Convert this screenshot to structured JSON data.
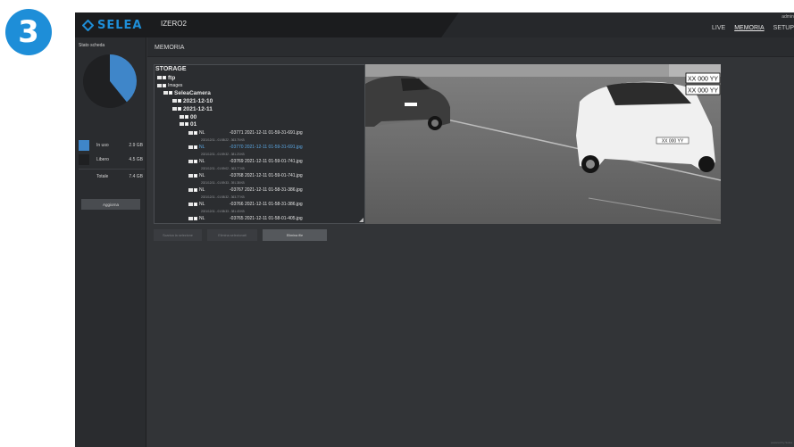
{
  "step_badge": "3",
  "brand": {
    "name": "SELEA",
    "accent": "#1e8ed8"
  },
  "device_name": "IZERO2",
  "user": {
    "name": "admin"
  },
  "nav": {
    "live": "LIVE",
    "memoria": "MEMORIA",
    "setup": "SETUP",
    "active": "MEMORIA"
  },
  "sidebar": {
    "title": "Stato scheda",
    "chart_data": {
      "type": "pie",
      "slices": [
        {
          "label": "In uso",
          "value": 2.9,
          "color": "#3f86c9"
        },
        {
          "label": "Libero",
          "value": 4.5,
          "color": "#1f2022"
        }
      ]
    },
    "legend": [
      {
        "label": "In uso",
        "value": "2.9 GB",
        "color": "#3f86c9"
      },
      {
        "label": "Libero",
        "value": "4.5 GB",
        "color": "#1f2022"
      },
      {
        "label": "Totale",
        "value": "7.4 GB",
        "color": ""
      }
    ],
    "update_button": "Aggiorna"
  },
  "page_title": "MEMORIA",
  "tree": {
    "title": "STORAGE",
    "nodes": [
      "ftp",
      "Images",
      "SeleaCamera",
      "2021-12-10",
      "2021-12-11",
      "00",
      "01"
    ],
    "files": [
      {
        "plate": "NL",
        "name": "-03771 2021-12-11 01-59-31-691.jpg",
        "meta": "2021/12/11 - 01:58:22 - 363.75 KB",
        "selected": false
      },
      {
        "plate": "NL",
        "name": "-03770 2021-12-11 01-59-31-691.jpg",
        "meta": "2021/12/11 - 01:59:32 - 381.23 KB",
        "selected": true
      },
      {
        "plate": "NL",
        "name": "-03769 2021-12-11 01-59-01-741.jpg",
        "meta": "2021/12/11 - 01:59:02 - 363.77 KB",
        "selected": false
      },
      {
        "plate": "NL",
        "name": "-03768 2021-12-11 01-59-01-741.jpg",
        "meta": "2021/12/11 - 01:59:33 - 391.38 KB",
        "selected": false
      },
      {
        "plate": "NL",
        "name": "-03767 2021-12-11 01-58-31-386.jpg",
        "meta": "2021/12/11 - 01:58:32 - 363.77 KB",
        "selected": false
      },
      {
        "plate": "NL",
        "name": "-03766 2021-12-11 01-58-31-386.jpg",
        "meta": "2021/12/11 - 01:58:33 - 381.43 KB",
        "selected": false
      },
      {
        "plate": "NL",
        "name": "-03765 2021-12-11 01-58-01-405.jpg",
        "meta": "",
        "selected": false
      }
    ]
  },
  "preview": {
    "plates": [
      "XX 000 YY",
      "XX 000 YY",
      "XX 000 YY"
    ]
  },
  "actions": {
    "download": "Scarica la selezione",
    "delete_selected": "Elimina selezionati",
    "delete_file": "Elimina file"
  },
  "footer": {
    "powered": "powered by Selea"
  }
}
